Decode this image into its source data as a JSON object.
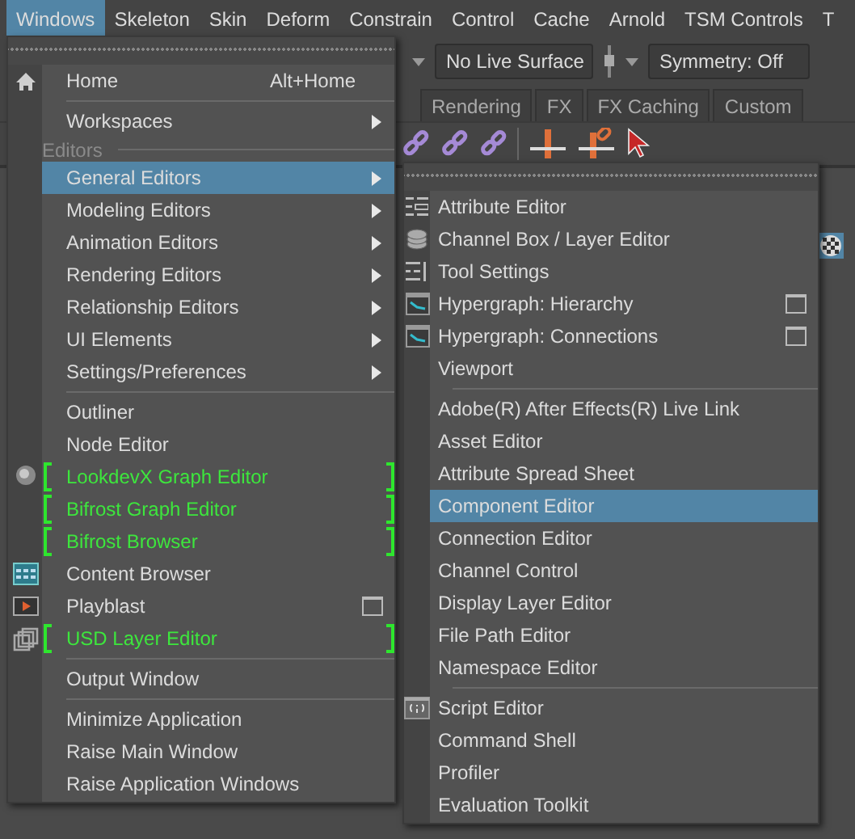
{
  "menubar": [
    {
      "label": "Windows",
      "selected": true
    },
    {
      "label": "Skeleton",
      "selected": false
    },
    {
      "label": "Skin",
      "selected": false
    },
    {
      "label": "Deform",
      "selected": false
    },
    {
      "label": "Constrain",
      "selected": false
    },
    {
      "label": "Control",
      "selected": false
    },
    {
      "label": "Cache",
      "selected": false
    },
    {
      "label": "Arnold",
      "selected": false
    },
    {
      "label": "TSM Controls",
      "selected": false
    },
    {
      "label": "T",
      "selected": false
    }
  ],
  "toolbar": {
    "live_surface": "No Live Surface",
    "symmetry": "Symmetry: Off"
  },
  "shelf_tabs": [
    {
      "label": "Rendering",
      "selected": false
    },
    {
      "label": "FX",
      "selected": false
    },
    {
      "label": "FX Caching",
      "selected": false
    },
    {
      "label": "Custom",
      "selected": false
    }
  ],
  "windows_menu": {
    "items": [
      {
        "kind": "item",
        "label": "Home",
        "shortcut": "Alt+Home",
        "selected": false
      },
      {
        "kind": "separator"
      },
      {
        "kind": "item",
        "label": "Workspaces",
        "submenu": true,
        "selected": false
      },
      {
        "kind": "heading",
        "label": "Editors"
      },
      {
        "kind": "item",
        "label": "General Editors",
        "submenu": true,
        "selected": true
      },
      {
        "kind": "item",
        "label": "Modeling Editors",
        "submenu": true,
        "selected": false
      },
      {
        "kind": "item",
        "label": "Animation Editors",
        "submenu": true,
        "selected": false
      },
      {
        "kind": "item",
        "label": "Rendering Editors",
        "submenu": true,
        "selected": false
      },
      {
        "kind": "item",
        "label": "Relationship Editors",
        "submenu": true,
        "selected": false
      },
      {
        "kind": "item",
        "label": "UI Elements",
        "submenu": true,
        "selected": false
      },
      {
        "kind": "item",
        "label": "Settings/Preferences",
        "submenu": true,
        "selected": false
      },
      {
        "kind": "separator"
      },
      {
        "kind": "item",
        "label": "Outliner",
        "selected": false
      },
      {
        "kind": "item",
        "label": "Node Editor",
        "selected": false
      },
      {
        "kind": "item",
        "label": "LookdevX Graph Editor",
        "plugin": true,
        "selected": false
      },
      {
        "kind": "item",
        "label": "Bifrost Graph Editor",
        "plugin": true,
        "selected": false
      },
      {
        "kind": "item",
        "label": "Bifrost Browser",
        "plugin": true,
        "selected": false
      },
      {
        "kind": "item",
        "label": "Content Browser",
        "selected": false
      },
      {
        "kind": "item",
        "label": "Playblast",
        "option_box": true,
        "selected": false
      },
      {
        "kind": "item",
        "label": "USD Layer Editor",
        "plugin": true,
        "selected": false
      },
      {
        "kind": "separator"
      },
      {
        "kind": "item",
        "label": "Output Window",
        "selected": false
      },
      {
        "kind": "separator"
      },
      {
        "kind": "item",
        "label": "Minimize Application",
        "selected": false
      },
      {
        "kind": "item",
        "label": "Raise Main Window",
        "selected": false
      },
      {
        "kind": "item",
        "label": "Raise Application Windows",
        "selected": false
      }
    ]
  },
  "general_editors_menu": {
    "items": [
      {
        "kind": "item",
        "label": "Attribute Editor",
        "selected": false
      },
      {
        "kind": "item",
        "label": "Channel Box / Layer Editor",
        "selected": false
      },
      {
        "kind": "item",
        "label": "Tool Settings",
        "selected": false
      },
      {
        "kind": "item",
        "label": "Hypergraph: Hierarchy",
        "option_box": true,
        "selected": false
      },
      {
        "kind": "item",
        "label": "Hypergraph: Connections",
        "option_box": true,
        "selected": false
      },
      {
        "kind": "item",
        "label": "Viewport",
        "selected": false
      },
      {
        "kind": "separator"
      },
      {
        "kind": "item",
        "label": "Adobe(R) After Effects(R) Live Link",
        "selected": false
      },
      {
        "kind": "item",
        "label": "Asset Editor",
        "selected": false
      },
      {
        "kind": "item",
        "label": "Attribute Spread Sheet",
        "selected": false
      },
      {
        "kind": "item",
        "label": "Component Editor",
        "selected": true
      },
      {
        "kind": "item",
        "label": "Connection Editor",
        "selected": false
      },
      {
        "kind": "item",
        "label": "Channel Control",
        "selected": false
      },
      {
        "kind": "item",
        "label": "Display Layer Editor",
        "selected": false
      },
      {
        "kind": "item",
        "label": "File Path Editor",
        "selected": false
      },
      {
        "kind": "item",
        "label": "Namespace Editor",
        "selected": false
      },
      {
        "kind": "separator"
      },
      {
        "kind": "item",
        "label": "Script Editor",
        "selected": false
      },
      {
        "kind": "item",
        "label": "Command Shell",
        "selected": false
      },
      {
        "kind": "item",
        "label": "Profiler",
        "selected": false
      },
      {
        "kind": "item",
        "label": "Evaluation Toolkit",
        "selected": false
      }
    ]
  }
}
